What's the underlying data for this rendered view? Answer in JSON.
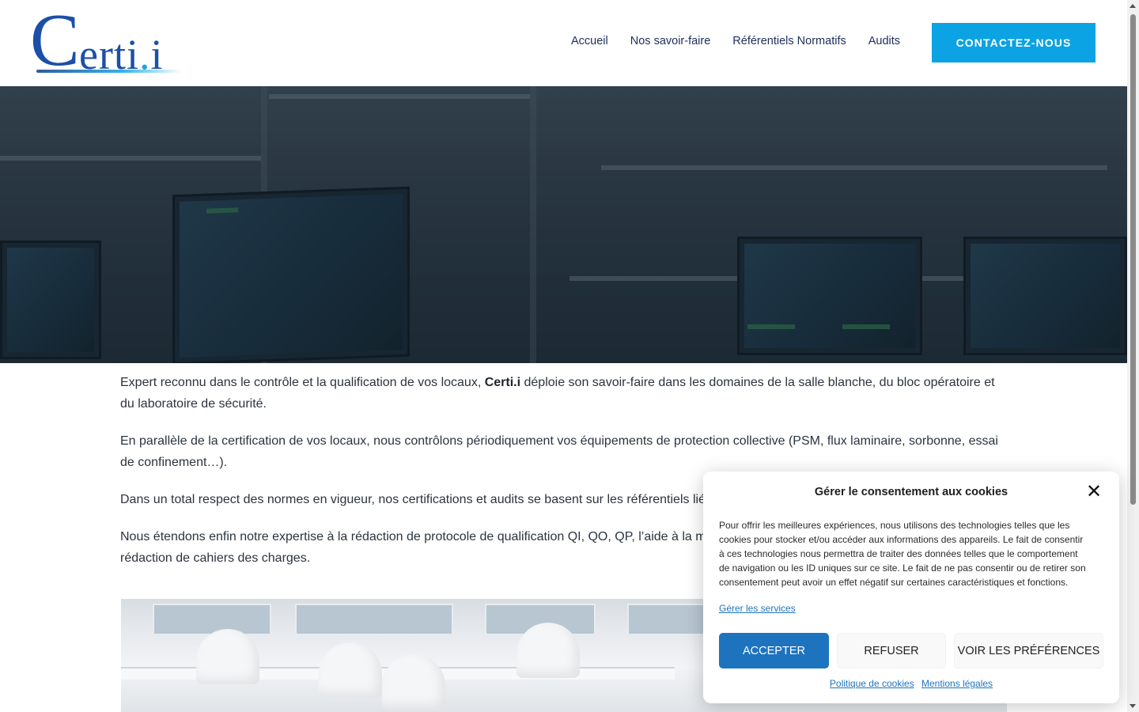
{
  "header": {
    "logo_text_c": "C",
    "logo_text_rest": "erti",
    "logo_dot": ".",
    "logo_i": "i",
    "nav": [
      {
        "label": "Accueil"
      },
      {
        "label": "Nos savoir-faire"
      },
      {
        "label": "Référentiels Normatifs"
      },
      {
        "label": "Audits"
      }
    ],
    "cta_label": "CONTACTEZ-NOUS"
  },
  "content": {
    "p1_before": "Expert reconnu dans le contrôle et la qualification de vos locaux, ",
    "p1_brand": "Certi.i",
    "p1_after": " déploie son savoir-faire dans les domaines de la salle blanche, du bloc opératoire et du laboratoire de sécurité.",
    "p2": "En parallèle de la certification de vos locaux, nous contrôlons périodiquement vos équipements de protection collective (PSM, flux laminaire, sorbonne, essai de confinement…).",
    "p3": "Dans un total respect des normes en vigueur, nos certifications et audits se basent sur les référentiels lié",
    "p4": "Nous étendons enfin notre expertise à la rédaction de protocole de qualification QI, QO, QP, l’aide à la ma",
    "p4_line2": "rédaction de cahiers des charges."
  },
  "cookie": {
    "title": "Gérer le consentement aux cookies",
    "close_glyph": "✕",
    "body": "Pour offrir les meilleures expériences, nous utilisons des technologies telles que les cookies pour stocker et/ou accéder aux informations des appareils. Le fait de consentir à ces technologies nous permettra de traiter des données telles que le comportement de navigation ou les ID uniques sur ce site. Le fait de ne pas consentir ou de retirer son consentement peut avoir un effet négatif sur certaines caractéristiques et fonctions.",
    "manage_link": "Gérer les services",
    "accept": "ACCEPTER",
    "refuse": "REFUSER",
    "prefs": "VOIR LES PRÉFÉRENCES",
    "policy_link": "Politique de cookies",
    "legal_link": "Mentions légales"
  },
  "colors": {
    "accent": "#0ba3e3",
    "nav_text": "#1f2d5c",
    "cookie_accept": "#1e73be"
  },
  "icons": {
    "close": "close-icon"
  }
}
